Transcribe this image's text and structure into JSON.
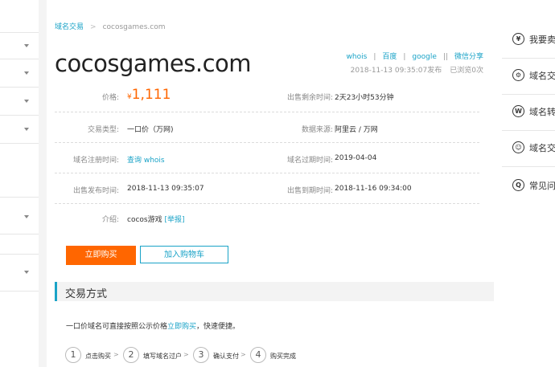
{
  "breadcrumb": {
    "parent": "域名交易",
    "separator": ">",
    "current": "cocosgames.com"
  },
  "domain_title": "cocosgames.com",
  "share_links": [
    {
      "label": "whois"
    },
    {
      "label": "百度"
    },
    {
      "label": "google"
    },
    {
      "label": "微信分享"
    }
  ],
  "share_separators": [
    "|",
    "|",
    "||"
  ],
  "meta": {
    "published": "2018-11-13 09:35:07发布",
    "viewed": "已浏览0次"
  },
  "info": {
    "price_label": "价格:",
    "price_currency": "¥",
    "price_value": "1,111",
    "remaining_label": "出售剩余时间:",
    "remaining_value": "2天23小时53分钟",
    "trade_type_label": "交易类型:",
    "trade_type_value": "一口价（万网)",
    "source_label": "数据来源:",
    "source_value": "阿里云 / 万网",
    "reg_time_label": "域名注册时间:",
    "reg_time_value": "查询 whois",
    "expire_label": "域名过期时间:",
    "expire_value": "2019-04-04",
    "publish_label": "出售发布时间:",
    "publish_value": "2018-11-13 09:35:07",
    "end_label": "出售到期时间:",
    "end_value": "2018-11-16 09:34:00",
    "intro_label": "介绍:",
    "intro_value": "cocos游戏",
    "intro_report": "[举报]"
  },
  "buttons": {
    "buy": "立即购买",
    "cart": "加入购物车"
  },
  "section": {
    "title": "交易方式"
  },
  "description": {
    "text_before": "一口价域名可直接按照公示价格",
    "link": "立即购买",
    "text_after": "，快速便捷。"
  },
  "steps": [
    {
      "num": "1",
      "label": "点击购买"
    },
    {
      "num": "2",
      "label": "填写域名过户"
    },
    {
      "num": "3",
      "label": "确认支付"
    },
    {
      "num": "4",
      "label": "购买完成"
    }
  ],
  "step_arrow": ">",
  "right_menu": [
    {
      "icon": "¥",
      "label": "我要卖"
    },
    {
      "icon": "⚙",
      "label": "域名交"
    },
    {
      "icon": "W",
      "label": "域名转"
    },
    {
      "icon": "☺",
      "label": "域名交"
    },
    {
      "icon": "Q",
      "label": "常见问"
    }
  ]
}
